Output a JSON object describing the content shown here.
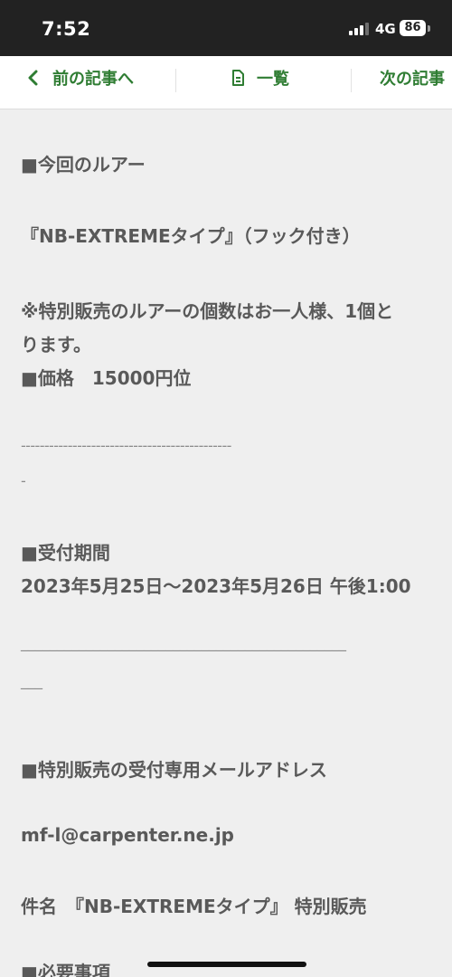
{
  "status_bar": {
    "time": "7:52",
    "network": "4G",
    "battery": "86"
  },
  "nav": {
    "prev_label": "前の記事へ",
    "list_label": "一覧",
    "next_label": "次の記事",
    "accent_color": "#2f7d33"
  },
  "article": {
    "lure_heading": "■今回のルアー",
    "lure_name": "『NB-EXTREMEタイプ』（フック付き）",
    "note_line1": "※特別販売のルアーの個数はお一人様、1個と",
    "note_line2": "ります。",
    "price": "■価格　15000円位",
    "separator1": "---------------------------------------------",
    "separator1_tail": "-",
    "period_heading": "■受付期間",
    "period_value": "2023年5月25日〜2023年5月26日 午後1:00",
    "separator2": "_____________________________________________",
    "separator2_tail": "___",
    "email_heading": "■特別販売の受付専用メールアドレス",
    "email": "mf-l@carpenter.ne.jp",
    "subject": "件名　『NB-EXTREMEタイプ』 特別販売",
    "required_heading": "■必要事項"
  }
}
